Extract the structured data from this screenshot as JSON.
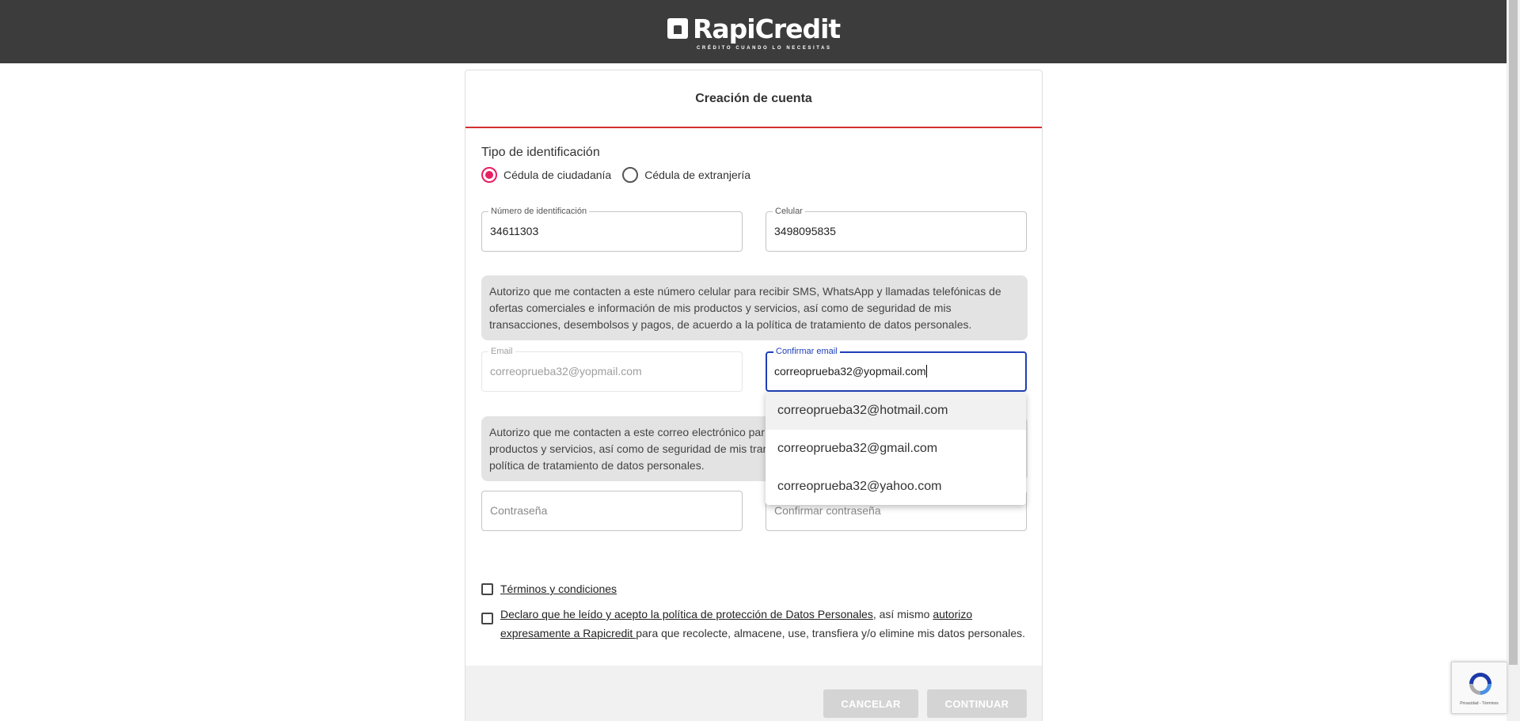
{
  "brand": {
    "name": "RapiCredit",
    "tagline": "CRÉDITO CUANDO LO NECESITAS"
  },
  "form": {
    "title": "Creación de cuenta",
    "id_type_label": "Tipo de identificación",
    "id_type_options": [
      {
        "label": "Cédula de ciudadanía",
        "selected": true
      },
      {
        "label": "Cédula de extranjería",
        "selected": false
      }
    ],
    "id_number": {
      "label": "Número de identificación",
      "value": "34611303"
    },
    "phone": {
      "label": "Celular",
      "value": "3498095835"
    },
    "phone_notice": "Autorizo que me contacten a este número celular para recibir SMS, WhatsApp y llamadas telefónicas de ofertas comerciales e información de mis productos y servicios, así como de seguridad de mis transacciones, desembolsos y pagos, de acuerdo a la política de tratamiento de datos personales.",
    "email": {
      "label": "Email",
      "value": "correoprueba32@yopmail.com"
    },
    "confirm_email": {
      "label": "Confirmar email",
      "value": "correoprueba32@yopmail.com"
    },
    "email_notice_visible": "Autorizo que me contacten a este correo electrónico par",
    "email_notice_line2": "productos y servicios, así como de seguridad de mis tran",
    "email_notice_line3": "política de tratamiento de datos personales.",
    "password_placeholder": "Contraseña",
    "confirm_password_placeholder": "Confirmar contraseña",
    "terms_label": " Términos y condiciones ",
    "privacy": {
      "link1": " Declaro que he leído y acepto la política de protección de Datos Personales",
      "text1": ", así mismo ",
      "link2a": "autorizo ",
      "link2b": "expresamente a Rapicredit ",
      "text2": "para que recolecte, almacene, use, transfiera y/o elimine mis datos personales."
    },
    "cancel_label": "CANCELAR",
    "continue_label": "CONTINUAR"
  },
  "autocomplete": {
    "suggestions": [
      "correoprueba32@hotmail.com",
      "correoprueba32@gmail.com",
      "correoprueba32@yahoo.com"
    ]
  },
  "recaptcha": {
    "footer_text": "Privacidad - Términos"
  },
  "colors": {
    "header_bg": "#3c3c3c",
    "accent_red": "#d32f2f",
    "radio_pink": "#e91e63",
    "focus_blue": "#1e3fb8"
  }
}
